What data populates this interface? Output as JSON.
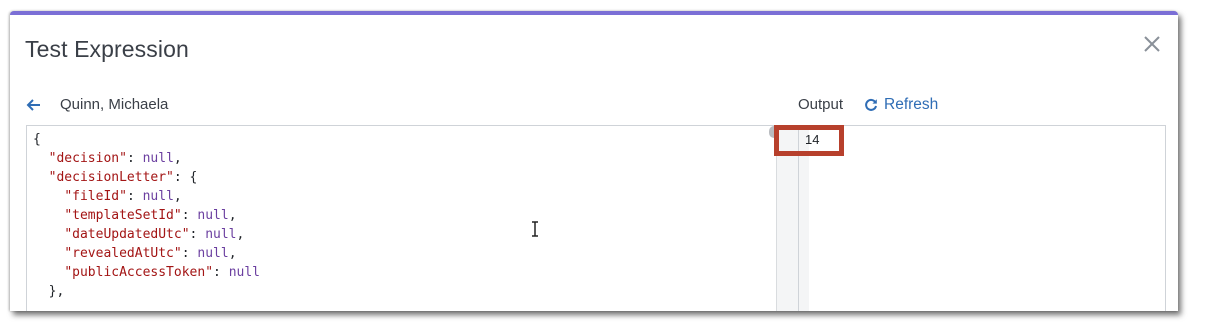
{
  "dialog": {
    "title": "Test Expression",
    "accent_color": "#7b6fd6"
  },
  "record": {
    "name": "Quinn, Michaela"
  },
  "output": {
    "label": "Output",
    "refresh_label": "Refresh",
    "value": "14",
    "highlight_color": "#b7402c"
  },
  "editor": {
    "lines": [
      "{",
      "  \"decision\": null,",
      "  \"decisionLetter\": {",
      "    \"fileId\": null,",
      "    \"templateSetId\": null,",
      "    \"dateUpdatedUtc\": null,",
      "    \"revealedAtUtc\": null,",
      "    \"publicAccessToken\": null",
      "  },"
    ]
  },
  "icons": {
    "close": "close-icon",
    "back": "arrow-left-icon",
    "refresh": "refresh-icon",
    "cursor": "text-cursor-icon"
  }
}
